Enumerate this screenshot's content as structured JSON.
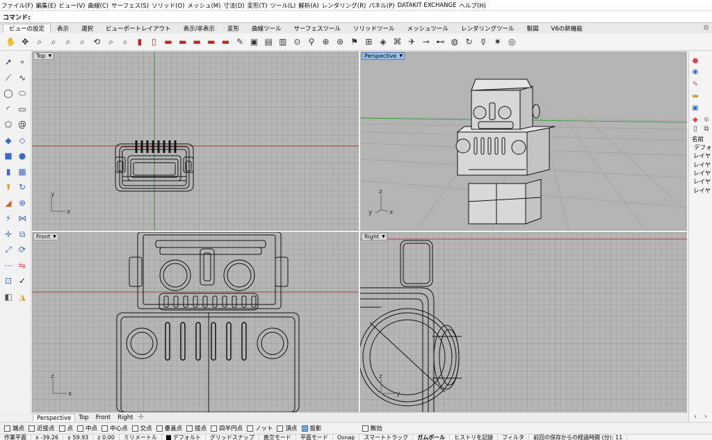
{
  "menu": [
    "ファイル(F)",
    "編集(E)",
    "ビュー(V)",
    "曲線(C)",
    "サーフェス(S)",
    "ソリッド(O)",
    "メッシュ(M)",
    "寸法(D)",
    "変形(T)",
    "ツール(L)",
    "解析(A)",
    "レンダリング(R)",
    "パネル(P)",
    "DATAKIT EXCHANGE",
    "ヘルプ(H)"
  ],
  "command": {
    "label": "コマンド:",
    "value": ""
  },
  "tabs": [
    "ビューの設定",
    "表示",
    "選択",
    "ビューポートレイアウト",
    "表示/非表示",
    "変形",
    "曲線ツール",
    "サーフェスツール",
    "ソリッドツール",
    "メッシュツール",
    "レンダリングツール",
    "製図",
    "V6の新機能"
  ],
  "active_tab": "ビューの設定",
  "toolbar_icons": [
    "pan-icon",
    "rotate-icon",
    "zoom-icon",
    "zoom-window-icon",
    "zoom-extents-icon",
    "zoom-selected-icon",
    "rotate-view-icon",
    "zoom-target-icon",
    "zoom-1-icon",
    "wallet-icon",
    "car-front-icon",
    "car-side-icon",
    "car-icon",
    "car-icon",
    "car-red-icon",
    "car-redo-icon",
    "named-view-icon",
    "camera-icon",
    "save-view-icon",
    "save-view-2-icon",
    "lock-icon",
    "match-view-icon",
    "target-icon",
    "target-alt-icon",
    "walk-icon",
    "plan-icon",
    "perspective-icon",
    "parallel-icon",
    "plane-icon",
    "ufo-icon",
    "saucer-icon",
    "sphere-icon",
    "orbit-icon",
    "person-icon",
    "starburst-icon",
    "circle-target-icon"
  ],
  "left_icons": [
    "select-icon",
    "point-icon",
    "polyline-icon",
    "curve-icon",
    "circle-icon",
    "ellipse-icon",
    "arc-icon",
    "rectangle-icon",
    "polygon-icon",
    "spiral-icon",
    "surface-icon",
    "patch-icon",
    "box-icon",
    "sphere-icon",
    "cylinder-icon",
    "mesh-icon",
    "extrude-icon",
    "revolve-icon",
    "fillet-icon",
    "boolean-icon",
    "split-icon",
    "join-icon",
    "move-icon",
    "copy-icon",
    "scale-icon",
    "rotate-icon",
    "array-icon",
    "mirror-icon",
    "group-icon",
    "check-icon",
    "layer-icon",
    "paint-icon"
  ],
  "viewports": {
    "top": "Top",
    "perspective": "Perspective",
    "front": "Front",
    "right": "Right",
    "top_axes": [
      "y",
      "x"
    ],
    "persp_axes": [
      "z",
      "y",
      "x"
    ],
    "front_axes": [
      "z",
      "x"
    ],
    "right_axes": [
      "z",
      "y"
    ]
  },
  "viewport_tabs": [
    "Perspective",
    "Top",
    "Front",
    "Right"
  ],
  "active_viewport_tab": "Perspective",
  "osnaps": [
    {
      "label": "端点",
      "checked": false
    },
    {
      "label": "近接点",
      "checked": false
    },
    {
      "label": "点",
      "checked": false
    },
    {
      "label": "中点",
      "checked": false
    },
    {
      "label": "中心点",
      "checked": false
    },
    {
      "label": "交点",
      "checked": false
    },
    {
      "label": "垂直点",
      "checked": false
    },
    {
      "label": "接点",
      "checked": false
    },
    {
      "label": "四半円点",
      "checked": false
    },
    {
      "label": "ノット",
      "checked": false
    },
    {
      "label": "頂点",
      "checked": false
    },
    {
      "label": "投影",
      "checked": true
    },
    {
      "label": "無効",
      "checked": false
    }
  ],
  "status": {
    "plane": "作業平面",
    "x": "x -39.26",
    "y": "y 59.93",
    "z": "z 0.00",
    "unit": "ミリメートル",
    "layer": "デフォルト",
    "grid_snap": "グリッドスナップ",
    "ortho": "直交モード",
    "planar": "平面モード",
    "osnap": "Osnap",
    "smarttrack": "スマートトラック",
    "gumball": "ガムボール",
    "history": "ヒストリを記録",
    "filter": "フィルタ",
    "elapsed": "前回の保存からの経過時間 (分): 11"
  },
  "right_panel": {
    "name_header": "名前",
    "layers": [
      "デフォ",
      "レイヤ",
      "レイヤ",
      "レイヤ",
      "レイヤ",
      "レイヤ"
    ]
  },
  "colors": {
    "viewport_bg": "#b5b5b5",
    "grid_major": "#a5a5a5",
    "x_axis": "#c04040",
    "y_axis": "#40a040",
    "active_viewport": "#9cc0ea"
  }
}
